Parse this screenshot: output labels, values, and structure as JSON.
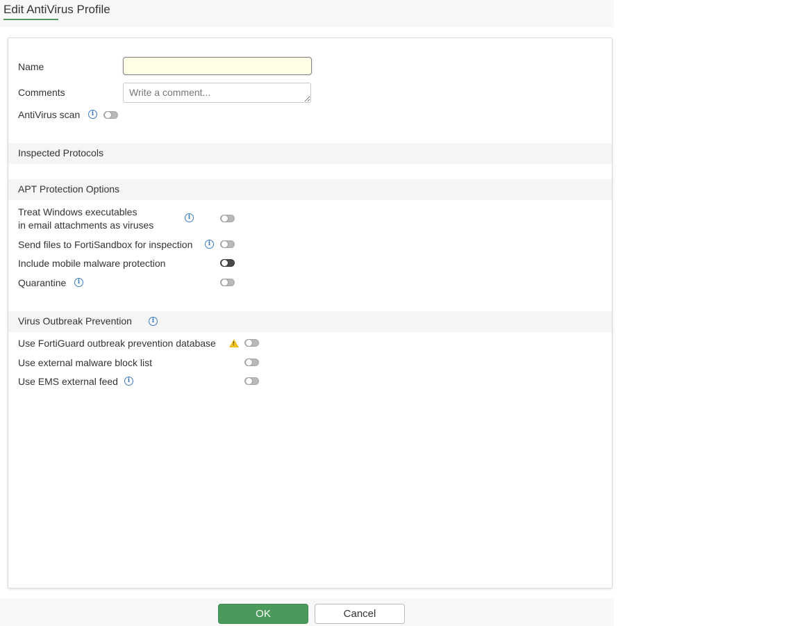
{
  "header": {
    "title": "Edit AntiVirus Profile"
  },
  "form": {
    "name_label": "Name",
    "name_value": "",
    "comments_label": "Comments",
    "comments_placeholder": "Write a comment...",
    "antivirus_scan_label": "AntiVirus scan"
  },
  "sections": {
    "inspected_protocols": "Inspected Protocols",
    "apt": {
      "title": "APT Protection Options",
      "treat_line1": "Treat Windows executables",
      "treat_line2": "in email attachments as viruses",
      "sandbox": "Send files to FortiSandbox for inspection",
      "mobile": "Include mobile malware protection",
      "quarantine": "Quarantine"
    },
    "outbreak": {
      "title": "Virus Outbreak Prevention",
      "fortiguard": "Use FortiGuard outbreak prevention database",
      "external_block": "Use external malware block list",
      "ems_feed": "Use EMS external feed"
    }
  },
  "footer": {
    "ok_label": "OK",
    "cancel_label": "Cancel"
  },
  "colors": {
    "accent": "#4c9a5b",
    "info": "#3b7bbf",
    "warning": "#f0c020"
  },
  "icons": {
    "info": "info-icon",
    "warning": "warning-icon"
  }
}
